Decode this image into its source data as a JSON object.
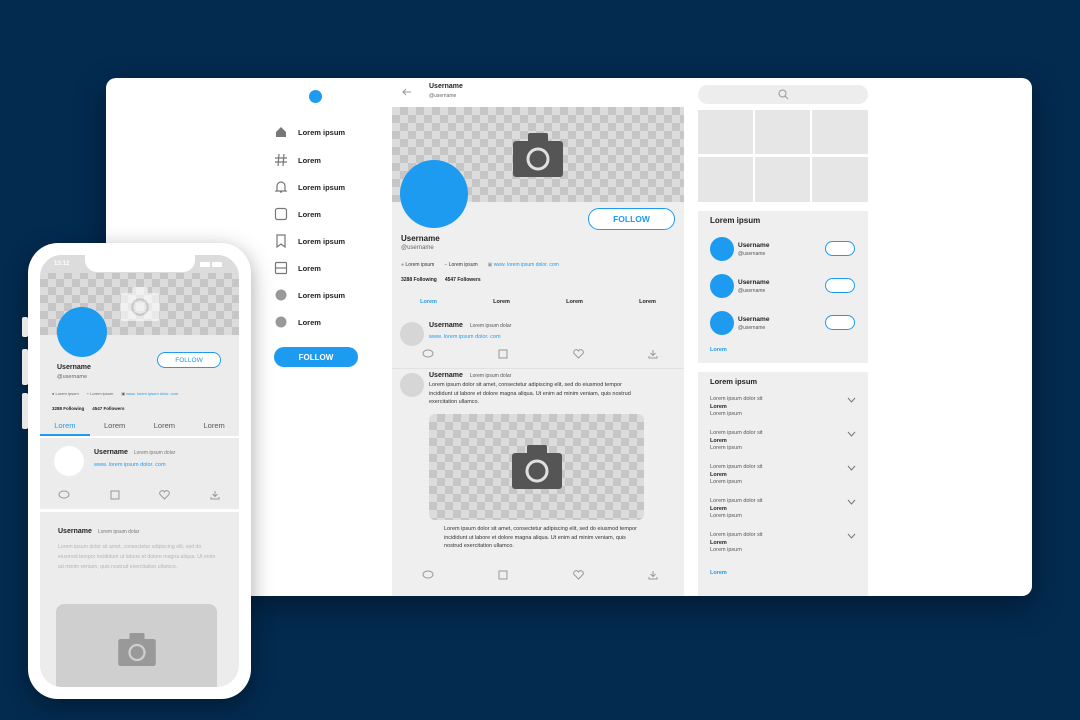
{
  "desktop": {
    "nav": [
      {
        "label": "Lorem ipsum",
        "icon": "home-icon"
      },
      {
        "label": "Lorem",
        "icon": "hashtag-icon"
      },
      {
        "label": "Lorem ipsum",
        "icon": "bell-icon"
      },
      {
        "label": "Lorem",
        "icon": "square-icon"
      },
      {
        "label": "Lorem ipsum",
        "icon": "bookmark-icon"
      },
      {
        "label": "Lorem",
        "icon": "list-icon"
      },
      {
        "label": "Lorem ipsum",
        "icon": "circle-icon"
      },
      {
        "label": "Lorem",
        "icon": "circle-icon"
      }
    ],
    "nav_follow": "FOLLOW",
    "header": {
      "name": "Username",
      "handle": "@username"
    },
    "profile": {
      "name": "Username",
      "handle": "@username",
      "follow": "FOLLOW",
      "location": "Lorem ipsum",
      "link_label": "Lorem ipsum",
      "url": "www. lorem ipsum dolor. com",
      "following": "3288 Following",
      "followers": "4547 Followers"
    },
    "tabs": [
      "Lorem",
      "Lorem",
      "Lorem",
      "Lorem"
    ],
    "post1": {
      "name": "Username",
      "meta": "Lorem ipsum dolar",
      "link": "www. lorem ipsum dolor. com"
    },
    "post2": {
      "name": "Username",
      "meta": "Lorem ipsum dolar",
      "text": "Lorem ipsum dolor sit amet, consectetur adipiscing elit, sed do eiusmod tempor incididunt ut labore et dolore magna aliqua. Ut enim ad minim veniam, quis nostrud exercitation ullamco.",
      "caption": "Lorem ipsum dolor sit amet, consectetur adipiscing elit, sed do eiusmod tempor incididunt ut labore et dolore magna aliqua. Ut enim ad minim veniam, quis nostrud exercitation ullamco."
    },
    "suggest": {
      "title": "Lorem ipsum",
      "users": [
        {
          "name": "Username",
          "handle": "@username"
        },
        {
          "name": "Username",
          "handle": "@username"
        },
        {
          "name": "Username",
          "handle": "@username"
        }
      ],
      "more": "Lorem"
    },
    "trends": {
      "title": "Lorem ipsum",
      "items": [
        {
          "top": "Lorem ipsum dolor sit",
          "main": "Lorem",
          "sub": "Lorem ipsum"
        },
        {
          "top": "Lorem ipsum dolor sit",
          "main": "Lorem",
          "sub": "Lorem ipsum"
        },
        {
          "top": "Lorem ipsum dolor sit",
          "main": "Lorem",
          "sub": "Lorem ipsum"
        },
        {
          "top": "Lorem ipsum dolor sit",
          "main": "Lorem",
          "sub": "Lorem ipsum"
        },
        {
          "top": "Lorem ipsum dolor sit",
          "main": "Lorem",
          "sub": "Lorem ipsum"
        }
      ],
      "more": "Lorem"
    }
  },
  "phone": {
    "time": "13:12",
    "name": "Username",
    "handle": "@username",
    "follow": "FOLLOW",
    "location": "Lorem ipsum",
    "link_label": "Lorem ipsum",
    "url": "www. lorem ipsum dolor. com",
    "following": "3288 Following",
    "followers": "4547 Followers",
    "tabs": [
      "Lorem",
      "Lorem",
      "Lorem",
      "Lorem"
    ],
    "post1": {
      "name": "Username",
      "meta": "Lorem ipsum dolar",
      "link": "www. lorem ipsum dolor. com"
    },
    "post2": {
      "name": "Username",
      "meta": "Lorem ipsum dolar",
      "text": "Lorem ipsum dolor sit amet, consectetur adipiscing elit, sed do eiusmod tempor incididunt ut labore et dolore magna aliqua. Ut enim ad minim veniam, quis nostrud exercitation ullamco."
    }
  },
  "colors": {
    "background": "#032a4f",
    "accent": "#1d9bf0"
  }
}
